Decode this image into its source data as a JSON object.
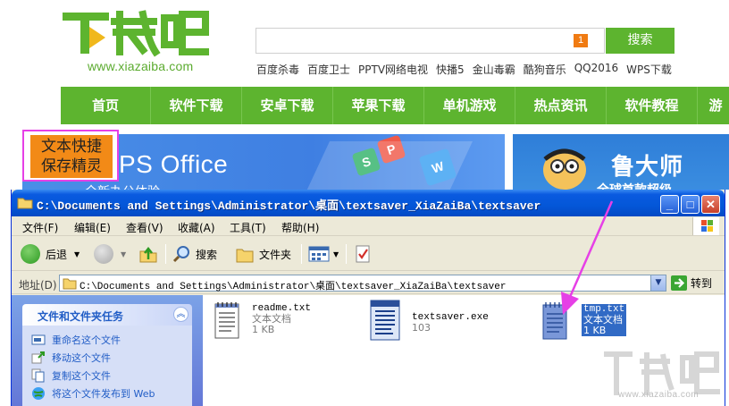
{
  "site": {
    "logo_text": "下载吧",
    "logo_url": "www.xiazaiba.com",
    "search_badge": "1",
    "search_button": "搜索",
    "hotlinks": [
      "百度杀毒",
      "百度卫士",
      "PPTV网络电视",
      "快播5",
      "金山毒霸",
      "酷狗音乐",
      "QQ2016",
      "WPS下载"
    ],
    "nav": [
      "首页",
      "软件下载",
      "安卓下载",
      "苹果下载",
      "单机游戏",
      "热点资讯",
      "软件教程",
      "游"
    ],
    "banner_left_title": "PS Office",
    "banner_left_sub": "全新办公体验",
    "banner_right_title": "鲁大师",
    "banner_right_sub": "全球首款超级",
    "callout": "文本快捷\n保存精灵",
    "colors": {
      "brand_green": "#5db42f",
      "callout_orange": "#f28a17",
      "highlight_magenta": "#e640e6",
      "xp_blue": "#0457d8"
    }
  },
  "explorer": {
    "title": "C:\\Documents and Settings\\Administrator\\桌面\\textsaver_XiaZaiBa\\textsaver",
    "title_buttons": [
      "minimize",
      "maximize",
      "close"
    ],
    "menu": [
      "文件(F)",
      "编辑(E)",
      "查看(V)",
      "收藏(A)",
      "工具(T)",
      "帮助(H)"
    ],
    "toolbar": {
      "back": "后退",
      "search": "搜索",
      "folders": "文件夹"
    },
    "address_label": "地址(D)",
    "address_value": "C:\\Documents and Settings\\Administrator\\桌面\\textsaver_XiaZaiBa\\textsaver",
    "go_label": "转到",
    "task_pane": {
      "title": "文件和文件夹任务",
      "items": [
        {
          "label": "重命名这个文件",
          "icon": "rename-icon"
        },
        {
          "label": "移动这个文件",
          "icon": "move-icon"
        },
        {
          "label": "复制这个文件",
          "icon": "copy-icon"
        },
        {
          "label": "将这个文件发布到 Web",
          "icon": "web-publish-icon"
        }
      ]
    },
    "files": [
      {
        "name": "readme.txt",
        "type": "文本文档",
        "size": "1 KB",
        "icon": "notepad-file-icon",
        "selected": false
      },
      {
        "name": "textsaver.exe",
        "type": "103",
        "size": "",
        "icon": "exe-file-icon",
        "selected": false
      },
      {
        "name": "tmp.txt",
        "type": "文本文档",
        "size": "1 KB",
        "icon": "notepad-file-icon",
        "selected": true
      }
    ]
  },
  "watermark": {
    "text": "下载吧",
    "url": "www.xiazaiba.com"
  }
}
